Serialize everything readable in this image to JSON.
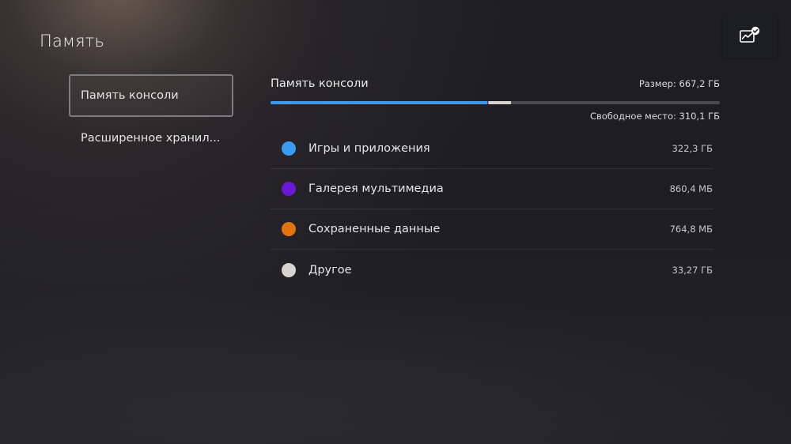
{
  "header": {
    "title": "Память",
    "action_icon": "storage-chart-check-icon"
  },
  "nav": {
    "items": [
      {
        "label": "Память консоли",
        "selected": true
      },
      {
        "label": "Расширенное хранил..."
      }
    ]
  },
  "storage": {
    "title": "Память консоли",
    "size_text": "Размер: 667,2 ГБ",
    "free_text": "Свободное место: 310,1 ГБ",
    "usage_fractions": {
      "games": 0.483,
      "media": 0.0013,
      "saves": 0.0011,
      "other": 0.0499
    },
    "colors": {
      "games": "#3b9af2",
      "media": "#6a18d8",
      "saves": "#e2730e",
      "other": "#d7d3cd",
      "track": "#4a4b51"
    }
  },
  "categories": [
    {
      "label": "Игры и приложения",
      "value": "322,3 ГБ",
      "color": "#3b9af2"
    },
    {
      "label": "Галерея мультимедиа",
      "value": "860,4 МБ",
      "color": "#6a18d8"
    },
    {
      "label": "Сохраненные данные",
      "value": "764,8 МБ",
      "color": "#e2730e"
    },
    {
      "label": "Другое",
      "value": "33,27 ГБ",
      "color": "#d7d3cd"
    }
  ]
}
